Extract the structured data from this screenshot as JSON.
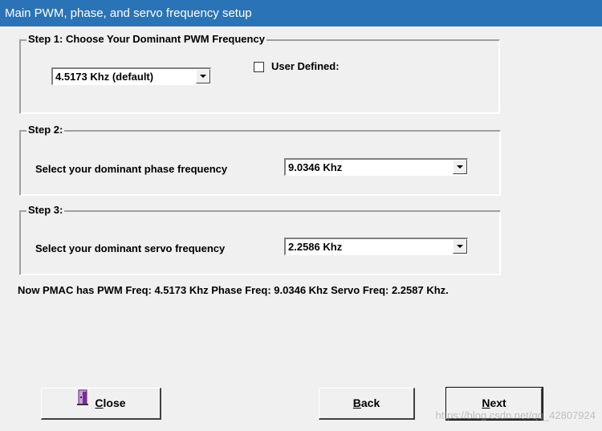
{
  "window": {
    "title": "Main PWM, phase, and servo frequency setup"
  },
  "step1": {
    "legend": "Step 1: Choose Your Dominant PWM Frequency",
    "pwm_select_value": "4.5173 Khz (default)",
    "user_defined_label": "User Defined:",
    "user_defined_checked": false
  },
  "step2": {
    "legend": "Step 2:",
    "label": "Select your dominant phase frequency",
    "phase_select_value": "9.0346 Khz"
  },
  "step3": {
    "legend": "Step 3:",
    "label": "Select your dominant servo frequency",
    "servo_select_value": "2.2586 Khz"
  },
  "status": {
    "text": "Now PMAC has PWM Freq: 4.5173 Khz Phase Freq: 9.0346 Khz Servo Freq: 2.2587 Khz."
  },
  "buttons": {
    "close_label_rest": "lose",
    "close_accel": "C",
    "back_label_rest": "ack",
    "back_accel": "B",
    "next_label_rest": "ext",
    "next_accel": "N",
    "close_icon": "door-exit-icon"
  },
  "watermark": {
    "text": "https://blog.csdn.net/qq_42807924"
  },
  "colors": {
    "titlebar": "#2b73b7",
    "background": "#f0f0f0"
  }
}
